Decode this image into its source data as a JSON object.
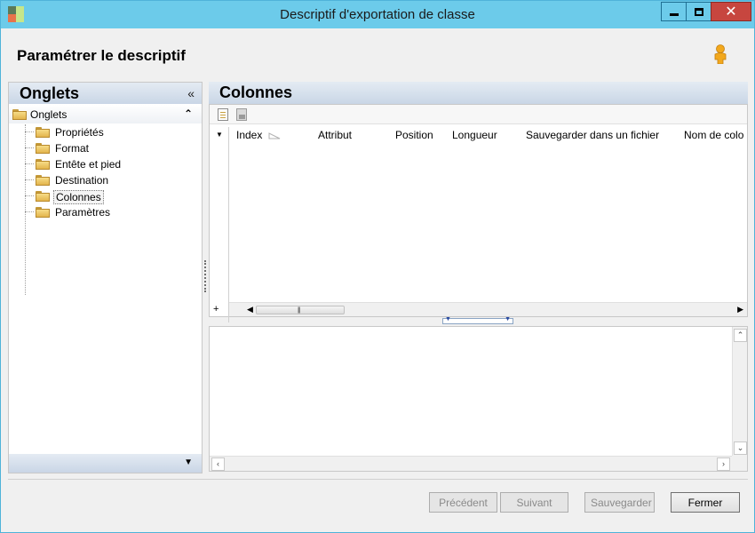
{
  "window": {
    "title": "Descriptif d'exportation de classe",
    "icon": "app-icon",
    "controls": {
      "minimize": "minimize-icon",
      "maximize": "maximize-icon",
      "close": "✕"
    }
  },
  "header": {
    "title": "Paramétrer le descriptif",
    "user_icon": "user-icon"
  },
  "left_panel": {
    "title": "Onglets",
    "collapse_glyph": "«",
    "tree_root": "Onglets",
    "tree_root_toggle": "⌃",
    "items": [
      {
        "label": "Propriétés"
      },
      {
        "label": "Format"
      },
      {
        "label": "Entête et pied"
      },
      {
        "label": "Destination"
      },
      {
        "label": "Colonnes",
        "selected": true
      },
      {
        "label": "Paramètres"
      }
    ],
    "footer_glyph": "▼"
  },
  "right_panel": {
    "title": "Colonnes",
    "toolbar": {
      "new_icon": "new-document-icon",
      "image_icon": "image-icon"
    },
    "grid": {
      "columns": [
        "Index",
        "Attribut",
        "Position",
        "Longueur",
        "Sauvegarder dans un fichier",
        "Nom de colo"
      ],
      "sorted_column": "Index",
      "add_glyph": "+"
    }
  },
  "footer": {
    "buttons": [
      {
        "label": "Précédent",
        "enabled": false
      },
      {
        "label": "Suivant",
        "enabled": false
      },
      {
        "label": "Sauvegarder",
        "enabled": false
      },
      {
        "label": "Fermer",
        "enabled": true
      }
    ]
  },
  "colors": {
    "titlebar": "#6ccbea",
    "close_button": "#c7463f",
    "panel_header": "#c9d6e6"
  }
}
